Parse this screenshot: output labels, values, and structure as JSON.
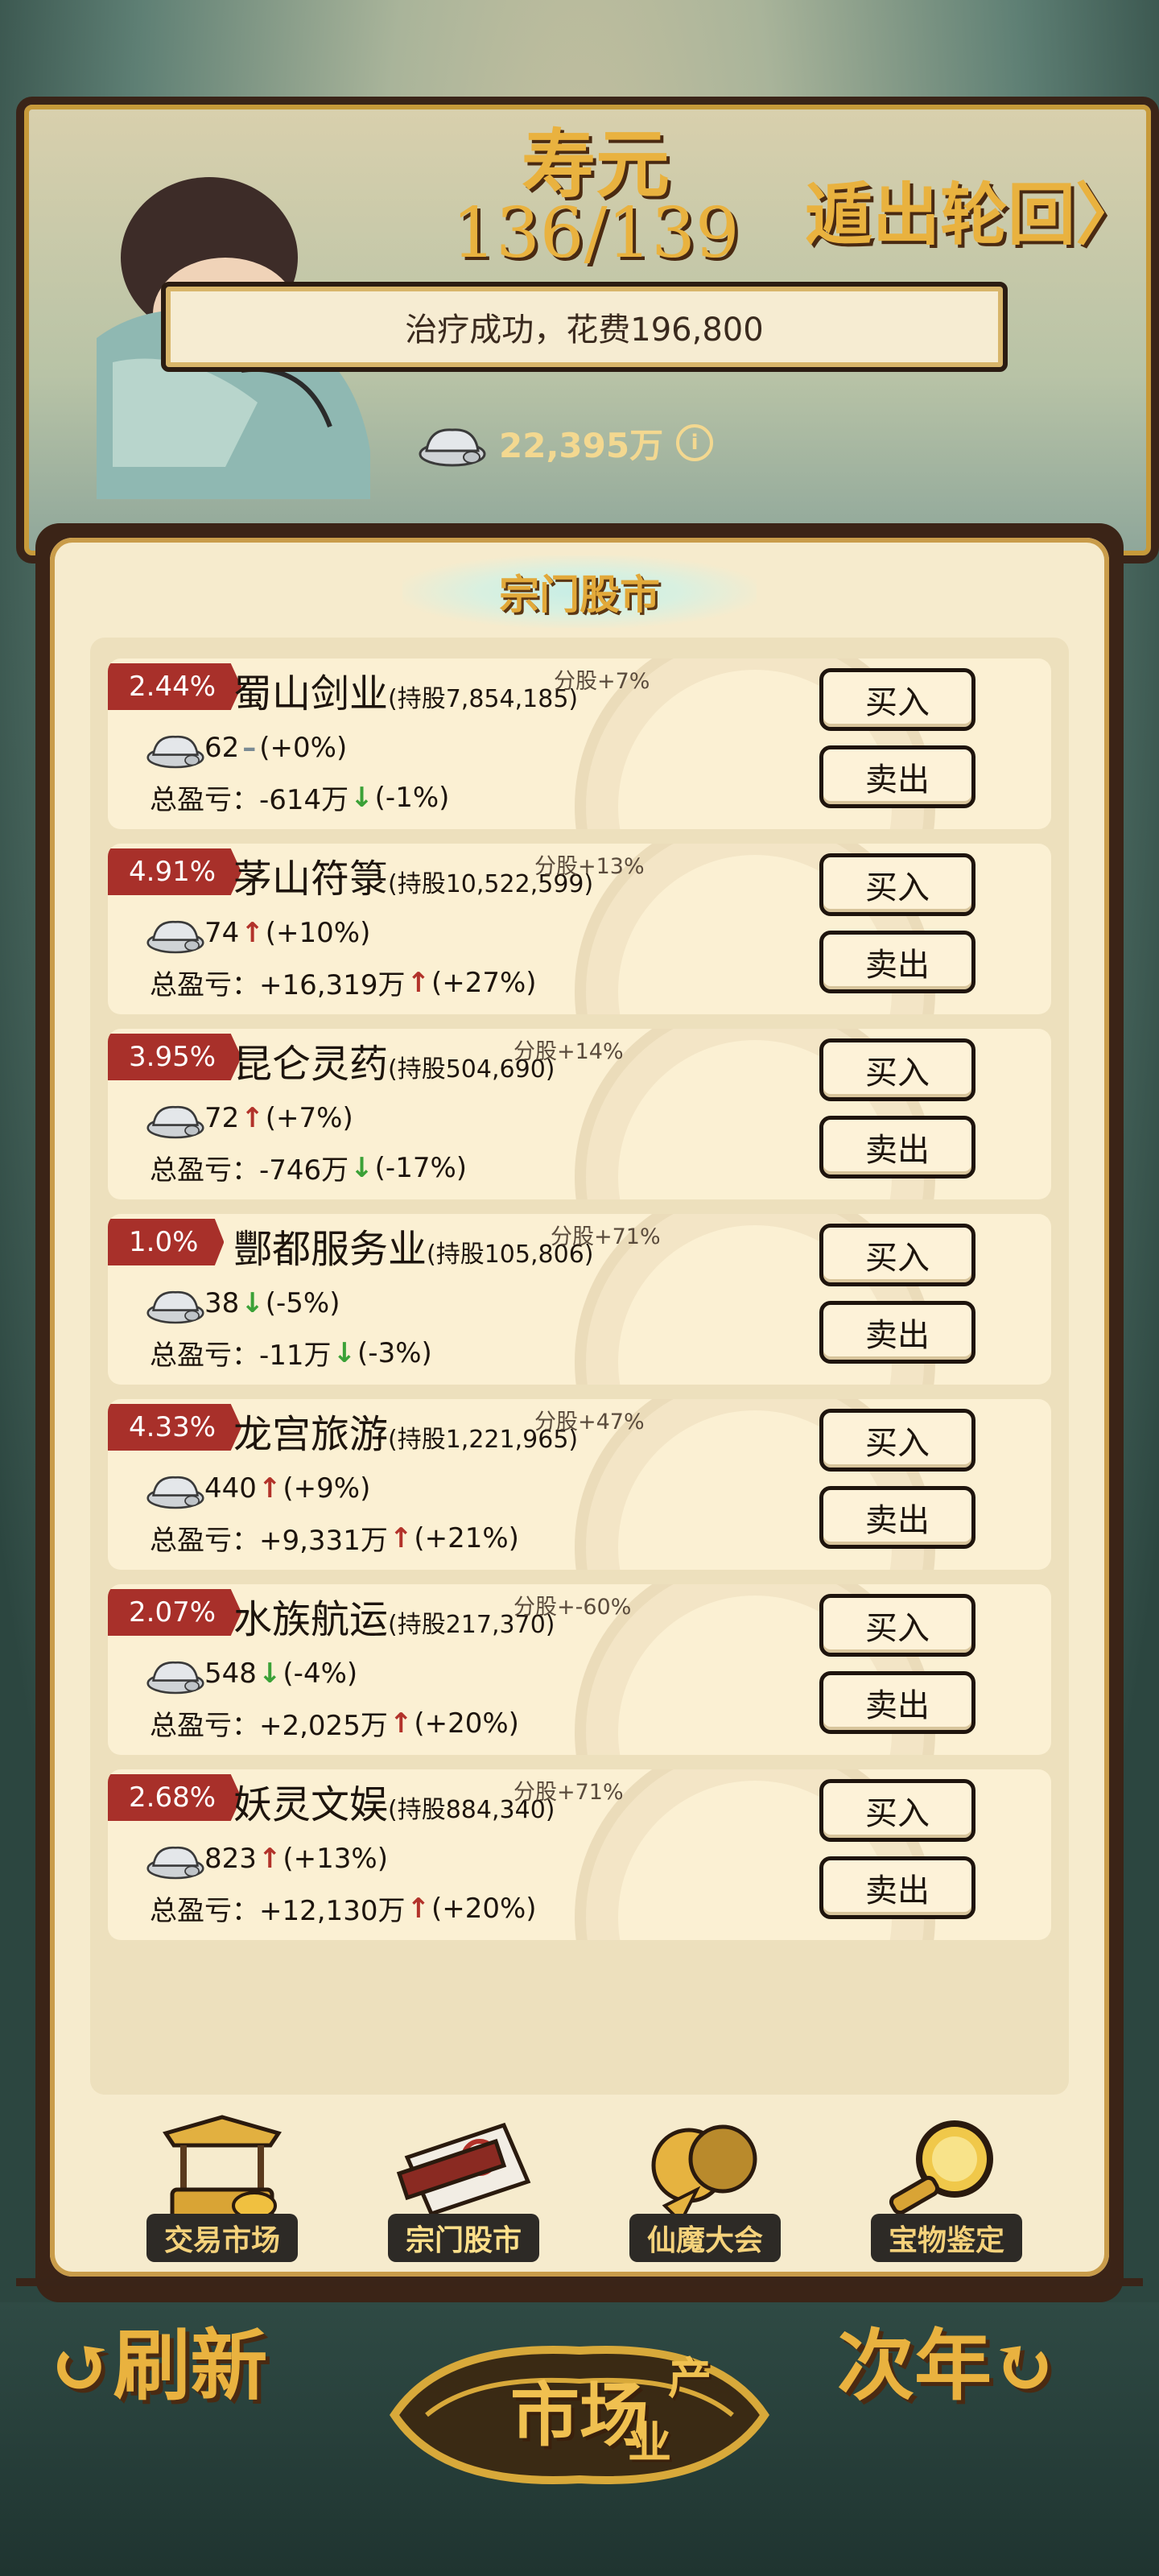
{
  "header": {
    "title": "寿元",
    "age": "136/139",
    "exit_label": "遁出轮回〉",
    "toast": "治疗成功，花费196,800",
    "money": "22,395万",
    "info_icon": "info-icon"
  },
  "panel": {
    "title": "宗门股市"
  },
  "stocks": [
    {
      "rate": "2.44%",
      "name": "蜀山剑业",
      "hold": "(持股7,854,185)",
      "dividend": "分股+7%",
      "price": "62",
      "change_dir": "flat",
      "change": "(+0%)",
      "pnl_label": "总盈亏：",
      "pnl": "-614万",
      "pnl_dir": "down",
      "pnl_pct": "(-1%)",
      "buy": "买入",
      "sell": "卖出"
    },
    {
      "rate": "4.91%",
      "name": "茅山符箓",
      "hold": "(持股10,522,599)",
      "dividend": "分股+13%",
      "price": "74",
      "change_dir": "up",
      "change": "(+10%)",
      "pnl_label": "总盈亏：",
      "pnl": "+16,319万",
      "pnl_dir": "up",
      "pnl_pct": "(+27%)",
      "buy": "买入",
      "sell": "卖出"
    },
    {
      "rate": "3.95%",
      "name": "昆仑灵药",
      "hold": "(持股504,690)",
      "dividend": "分股+14%",
      "price": "72",
      "change_dir": "up",
      "change": "(+7%)",
      "pnl_label": "总盈亏：",
      "pnl": "-746万",
      "pnl_dir": "down",
      "pnl_pct": "(-17%)",
      "buy": "买入",
      "sell": "卖出"
    },
    {
      "rate": "1.0%",
      "name": "酆都服务业",
      "hold": "(持股105,806)",
      "dividend": "分股+71%",
      "price": "38",
      "change_dir": "down",
      "change": "(-5%)",
      "pnl_label": "总盈亏：",
      "pnl": "-11万",
      "pnl_dir": "down",
      "pnl_pct": "(-3%)",
      "buy": "买入",
      "sell": "卖出"
    },
    {
      "rate": "4.33%",
      "name": "龙宫旅游",
      "hold": "(持股1,221,965)",
      "dividend": "分股+47%",
      "price": "440",
      "change_dir": "up",
      "change": "(+9%)",
      "pnl_label": "总盈亏：",
      "pnl": "+9,331万",
      "pnl_dir": "up",
      "pnl_pct": "(+21%)",
      "buy": "买入",
      "sell": "卖出"
    },
    {
      "rate": "2.07%",
      "name": "水族航运",
      "hold": "(持股217,370)",
      "dividend": "分股+-60%",
      "price": "548",
      "change_dir": "down",
      "change": "(-4%)",
      "pnl_label": "总盈亏：",
      "pnl": "+2,025万",
      "pnl_dir": "up",
      "pnl_pct": "(+20%)",
      "buy": "买入",
      "sell": "卖出"
    },
    {
      "rate": "2.68%",
      "name": "妖灵文娱",
      "hold": "(持股884,340)",
      "dividend": "分股+71%",
      "price": "823",
      "change_dir": "up",
      "change": "(+13%)",
      "pnl_label": "总盈亏：",
      "pnl": "+12,130万",
      "pnl_dir": "up",
      "pnl_pct": "(+20%)",
      "buy": "买入",
      "sell": "卖出"
    }
  ],
  "nav": [
    {
      "label": "交易市场",
      "icon": "market-stall-icon"
    },
    {
      "label": "宗门股市",
      "icon": "scroll-icon"
    },
    {
      "label": "仙魔大会",
      "icon": "mask-icon"
    },
    {
      "label": "宝物鉴定",
      "icon": "magnifier-icon"
    }
  ],
  "footer": {
    "refresh": "↺刷新",
    "next_year": "次年↻",
    "emblem": "市场",
    "emblem_sub1": "产",
    "emblem_sub2": "业"
  },
  "colors": {
    "rate_badge": "#a8302a",
    "up": "#b2322a",
    "down": "#3ba137",
    "gold_text": "#e9b23f",
    "panel_bg": "#f6ebcd"
  }
}
